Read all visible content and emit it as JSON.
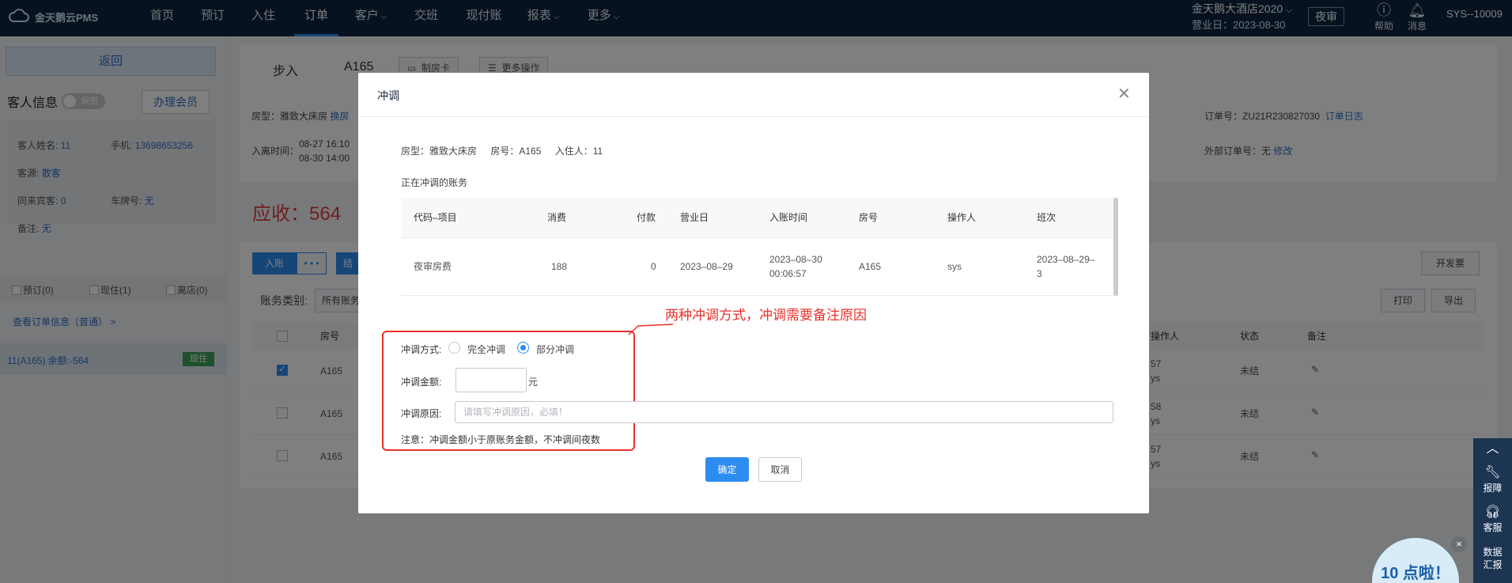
{
  "app": {
    "logo_text": "金天鹅云PMS"
  },
  "nav": {
    "items": [
      {
        "label": "首页",
        "caret": false
      },
      {
        "label": "预订",
        "caret": false
      },
      {
        "label": "入住",
        "caret": false
      },
      {
        "label": "订单",
        "caret": false,
        "active": true
      },
      {
        "label": "客户",
        "caret": true
      },
      {
        "label": "交班",
        "caret": false
      },
      {
        "label": "现付账",
        "caret": false
      },
      {
        "label": "报表",
        "caret": true
      },
      {
        "label": "更多",
        "caret": true
      }
    ],
    "hotel_name": "金天鹅大酒店2020",
    "business_date": "营业日：2023-08-30",
    "night_audit": "夜审",
    "help": "帮助",
    "messages": "消息",
    "user": "SYS--10009"
  },
  "left": {
    "back": "返回",
    "guest_info": "客人信息",
    "confidential": "保密",
    "member": "办理会员",
    "name_label": "客人姓名:",
    "name_value": "11",
    "phone_label": "手机:",
    "phone_value": "13698653256",
    "source_label": "客源:",
    "source_value": "散客",
    "companion_label": "同来宾客:",
    "companion_value": "0",
    "plate_label": "车牌号:",
    "plate_value": "无",
    "remark_label": "备注:",
    "remark_value": "无",
    "filter": [
      "预订(0)",
      "现住(1)",
      "离店(0)"
    ],
    "view_order": "查看订单信息（普通）  >",
    "room_entry": "11(A165)  余额:-564",
    "room_tag": "现住"
  },
  "main": {
    "step": "步入",
    "room": "A165",
    "make_card": "制房卡",
    "more_ops": "更多操作",
    "room_type_label": "房型：",
    "room_type_value": "雅致大床房",
    "change_room": "换房",
    "stay_label": "入离时间：",
    "checkin": "08-27 16:10",
    "checkout": "08-30 14:00",
    "order_no_label": "订单号：",
    "order_no_value": "ZU21R230827030",
    "order_log": "订单日志",
    "ext_order_label": "外部订单号：",
    "ext_order_value": "无",
    "modify": "修改",
    "receivable": "应收：564",
    "post_btn": "入账",
    "more_dots": "• • •",
    "settle": "结",
    "invoice": "开发票",
    "print": "打印",
    "export": "导出",
    "acct_type_label": "账务类别:",
    "acct_type_value": "所有账务",
    "table_headers": {
      "room": "房号",
      "operator": "操作人",
      "status": "状态",
      "remark": "备注"
    },
    "rows": [
      {
        "room": "A165",
        "op1": "57",
        "op2": "ys",
        "status": "未结",
        "checked": true
      },
      {
        "room": "A165",
        "op1": "58",
        "op2": "ys",
        "status": "未结",
        "checked": false
      },
      {
        "room": "A165",
        "op1": "57",
        "op2": "ys",
        "status": "未结",
        "checked": false
      }
    ]
  },
  "modal": {
    "title": "冲调",
    "room_type": "房型：雅致大床房",
    "room_no": "房号：A165",
    "occupant": "入住人：11",
    "acct_title": "正在冲调的账务",
    "headers": [
      "代码–项目",
      "消费",
      "付款",
      "营业日",
      "入账时间",
      "房号",
      "操作人",
      "班次"
    ],
    "row": {
      "item": "夜审房费",
      "consume": "188",
      "payment": "0",
      "biz_date": "2023–08–29",
      "post_time_1": "2023–08–30",
      "post_time_2": "00:06:57",
      "room": "A165",
      "operator": "sys",
      "shift_1": "2023–08–29–",
      "shift_2": "3"
    },
    "callout": "两种冲调方式，冲调需要备注原因",
    "method_label": "冲调方式:",
    "method_full": "完全冲调",
    "method_partial": "部分冲调",
    "amount_label": "冲调金额:",
    "amount_value": "",
    "yuan": "元",
    "reason_label": "冲调原因:",
    "reason_placeholder": "请填写冲调原因，必填！",
    "note": "注意：冲调金额小于原账务金额，不冲调间夜数",
    "ok": "确定",
    "cancel": "取消"
  },
  "float_bar": {
    "report": "报障",
    "service": "客服",
    "data_1": "数据",
    "data_2": "汇报"
  },
  "promo": "10 点啦！"
}
